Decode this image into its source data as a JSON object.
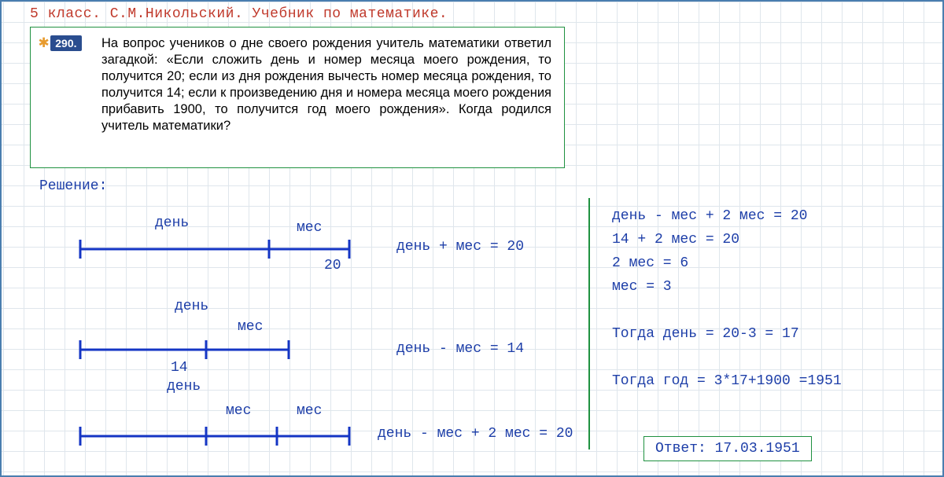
{
  "header": "5 класс. С.М.Никольский. Учебник по математике.",
  "problem": {
    "star": "✱",
    "number": "290.",
    "text": "На вопрос учеников о дне своего рождения учитель матема­тики ответил загадкой: «Если сложить день и номер месяца моего рождения, то получится 20; если из дня рождения вы­честь номер месяца рождения, то получится 14; если к про­изведению дня и номера месяца моего рождения приба­вить 1900, то получится год моего рождения». Когда родился учитель математики?"
  },
  "labels": {
    "solution": "Решение:",
    "day": "день",
    "month": "мес",
    "twenty": "20",
    "fourteen": "14"
  },
  "eq": {
    "eq1": "день + мес = 20",
    "eq2": "день - мес = 14",
    "eq3": "день - мес + 2 мес = 20"
  },
  "calc": {
    "l1": "день - мес + 2 мес = 20",
    "l2": "14 + 2 мес = 20",
    "l3": "2 мес = 6",
    "l4": "мес = 3",
    "l5": "Тогда день = 20-3 = 17",
    "l6": "Тогда год = 3*17+1900 =1951"
  },
  "answer": "Ответ: 17.03.1951"
}
